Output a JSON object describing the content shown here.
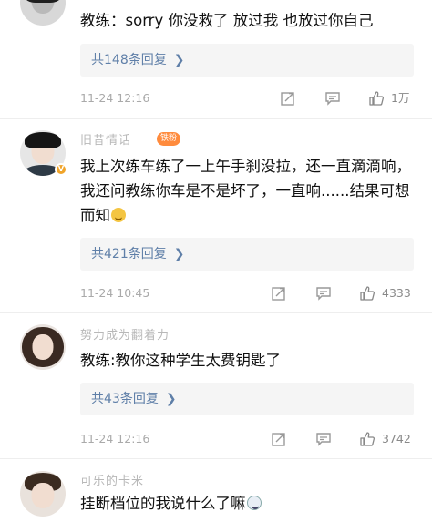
{
  "comments": [
    {
      "name": "",
      "content": "教练：sorry 你没救了 放过我 也放过你自己",
      "replies": "共148条回复",
      "time": "11-24 12:16",
      "likes": "1万"
    },
    {
      "name": "旧昔情话",
      "badge": "铁粉",
      "content": "我上次练车练了一上午手刹没拉，还一直滴滴响，我还问教练你车是不是坏了，一直响......结果可想而知",
      "replies": "共421条回复",
      "time": "11-24 10:45",
      "likes": "4333"
    },
    {
      "name": "努力成为翻着力",
      "content": "教练:教你这种学生太费钥匙了",
      "replies": "共43条回复",
      "time": "11-24 12:16",
      "likes": "3742"
    },
    {
      "name": "可乐的卡米",
      "content": "挂断档位的我说什么了嘛"
    }
  ],
  "icons": {
    "repost": "repost-icon",
    "comment": "comment-icon",
    "like": "thumbs-up-icon",
    "chevron": "chevron-right-icon"
  },
  "colors": {
    "link": "#5f7fa8",
    "muted": "#aaaaaa",
    "badge": "#ff8b3d"
  }
}
